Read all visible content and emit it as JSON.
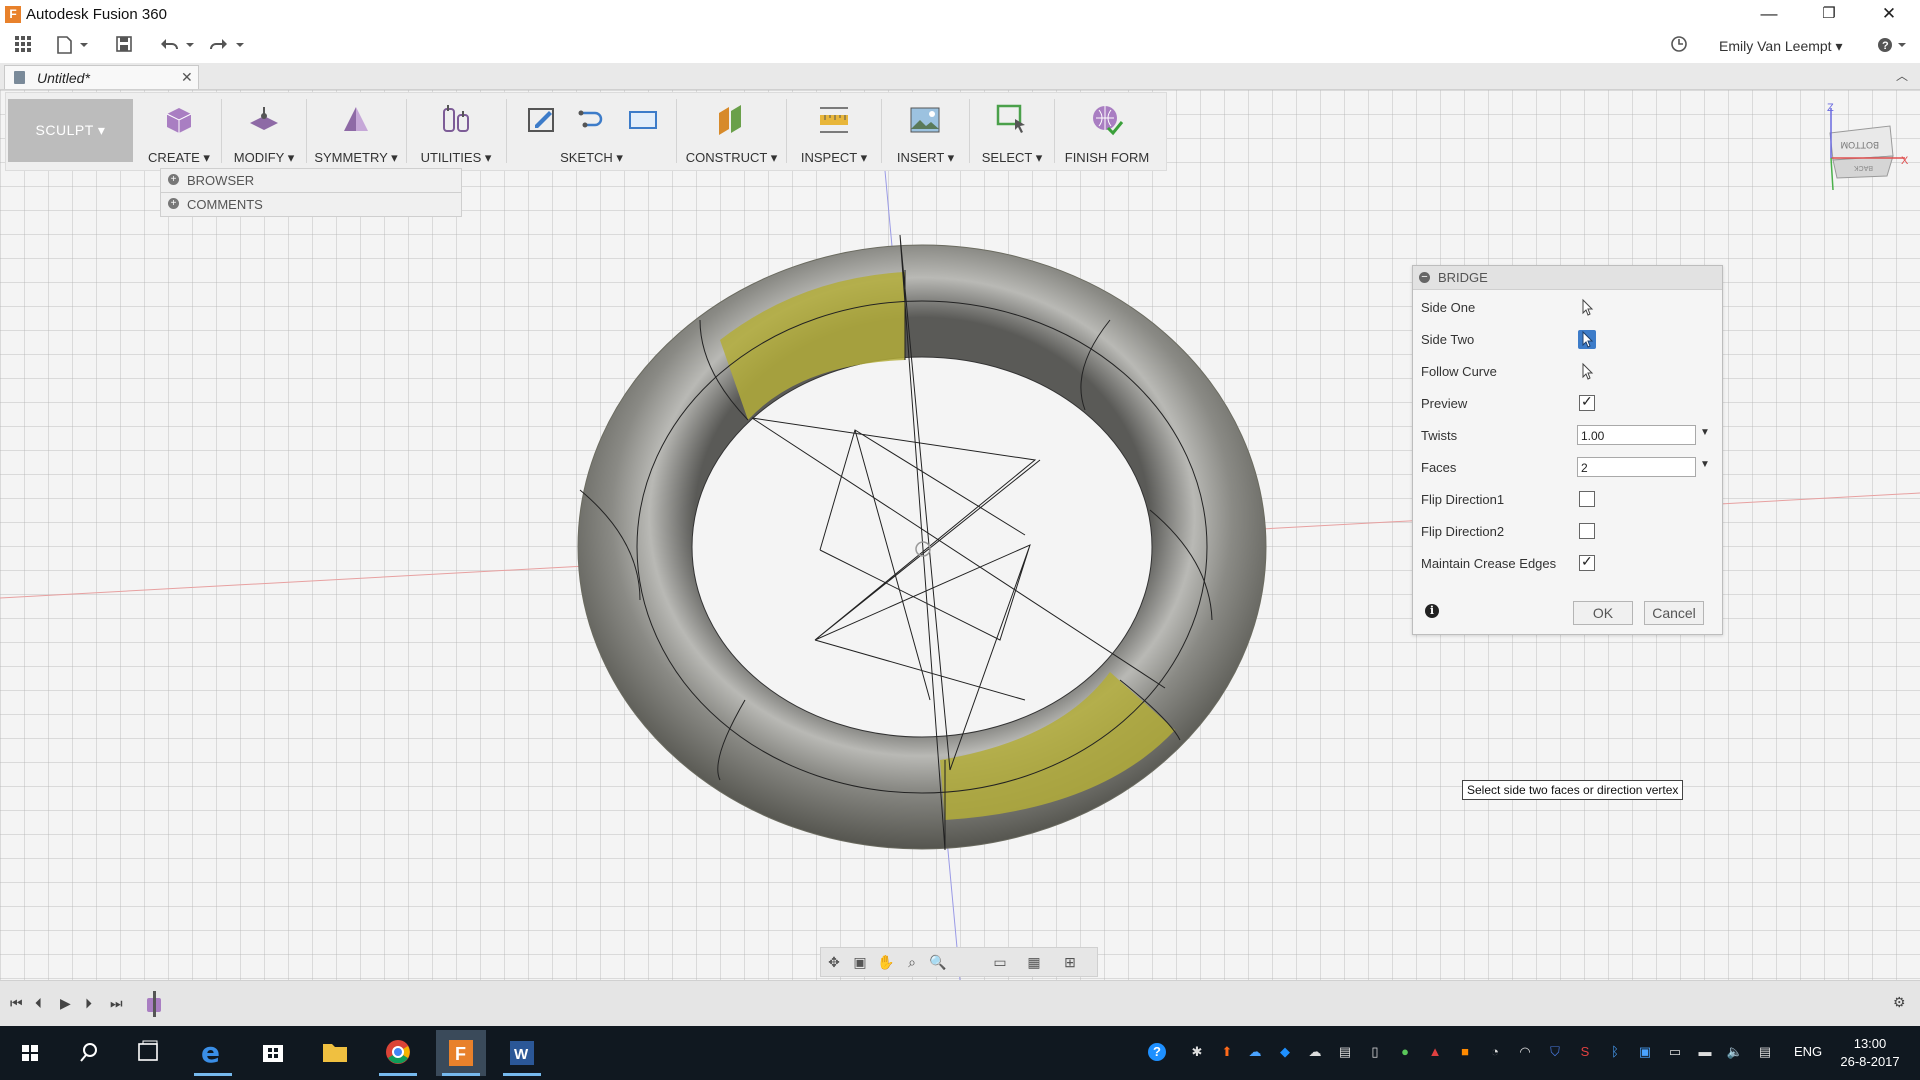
{
  "window": {
    "title": "Autodesk Fusion 360",
    "minimize": "—",
    "maximize": "❐",
    "close": "✕"
  },
  "quick_access": {
    "user": "Emily Van Leempt ▾"
  },
  "tab": {
    "label": "Untitled*",
    "close": "✕"
  },
  "toolbar": {
    "workspace": "SCULPT ▾",
    "groups": [
      "CREATE ▾",
      "MODIFY ▾",
      "SYMMETRY ▾",
      "UTILITIES ▾",
      "SKETCH ▾",
      "CONSTRUCT ▾",
      "INSPECT ▾",
      "INSERT ▾",
      "SELECT ▾",
      "FINISH FORM"
    ]
  },
  "panels": {
    "browser": "BROWSER",
    "comments": "COMMENTS"
  },
  "viewcube": {
    "face_label": "BOTTOM",
    "side_label": "BACK",
    "axis_x": "X",
    "axis_z": "Z"
  },
  "bridge": {
    "title": "BRIDGE",
    "side_one": "Side One",
    "side_two": "Side Two",
    "follow_curve": "Follow Curve",
    "preview": "Preview",
    "preview_checked": true,
    "twists": "Twists",
    "twists_value": "1.00",
    "faces": "Faces",
    "faces_value": "2",
    "flip1": "Flip Direction1",
    "flip2": "Flip Direction2",
    "crease": "Maintain Crease Edges",
    "crease_checked": true,
    "ok": "OK",
    "cancel": "Cancel"
  },
  "tooltip": "Select side two faces or direction vertex",
  "taskbar": {
    "lang": "ENG",
    "time": "13:00",
    "date": "26-8-2017"
  },
  "colors": {
    "accent": "#3d7cc9",
    "highlight_face": "#c9c23a",
    "torus": "#7b7b76",
    "taskbar": "#101820"
  }
}
